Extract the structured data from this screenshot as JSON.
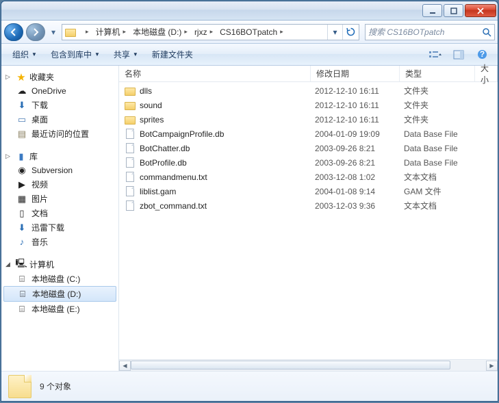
{
  "breadcrumb": [
    "计算机",
    "本地磁盘 (D:)",
    "rjxz",
    "CS16BOTpatch"
  ],
  "search_placeholder": "搜索 CS16BOTpatch",
  "toolbar": {
    "organize": "组织",
    "include": "包含到库中",
    "share": "共享",
    "newfolder": "新建文件夹"
  },
  "columns": {
    "name": "名称",
    "date": "修改日期",
    "type": "类型",
    "size": "大小"
  },
  "nav": {
    "fav": {
      "label": "收藏夹",
      "items": [
        "OneDrive",
        "下载",
        "桌面",
        "最近访问的位置"
      ]
    },
    "lib": {
      "label": "库",
      "items": [
        "Subversion",
        "视频",
        "图片",
        "文档",
        "迅雷下载",
        "音乐"
      ]
    },
    "comp": {
      "label": "计算机",
      "items": [
        "本地磁盘 (C:)",
        "本地磁盘 (D:)",
        "本地磁盘 (E:)"
      ]
    }
  },
  "files": [
    {
      "icon": "folder",
      "name": "dlls",
      "date": "2012-12-10 16:11",
      "type": "文件夹"
    },
    {
      "icon": "folder",
      "name": "sound",
      "date": "2012-12-10 16:11",
      "type": "文件夹"
    },
    {
      "icon": "folder",
      "name": "sprites",
      "date": "2012-12-10 16:11",
      "type": "文件夹"
    },
    {
      "icon": "db",
      "name": "BotCampaignProfile.db",
      "date": "2004-01-09 19:09",
      "type": "Data Base File"
    },
    {
      "icon": "db",
      "name": "BotChatter.db",
      "date": "2003-09-26 8:21",
      "type": "Data Base File"
    },
    {
      "icon": "db",
      "name": "BotProfile.db",
      "date": "2003-09-26 8:21",
      "type": "Data Base File"
    },
    {
      "icon": "txt",
      "name": "commandmenu.txt",
      "date": "2003-12-08 1:02",
      "type": "文本文档"
    },
    {
      "icon": "file",
      "name": "liblist.gam",
      "date": "2004-01-08 9:14",
      "type": "GAM 文件"
    },
    {
      "icon": "txt",
      "name": "zbot_command.txt",
      "date": "2003-12-03 9:36",
      "type": "文本文档"
    }
  ],
  "status": "9 个对象"
}
